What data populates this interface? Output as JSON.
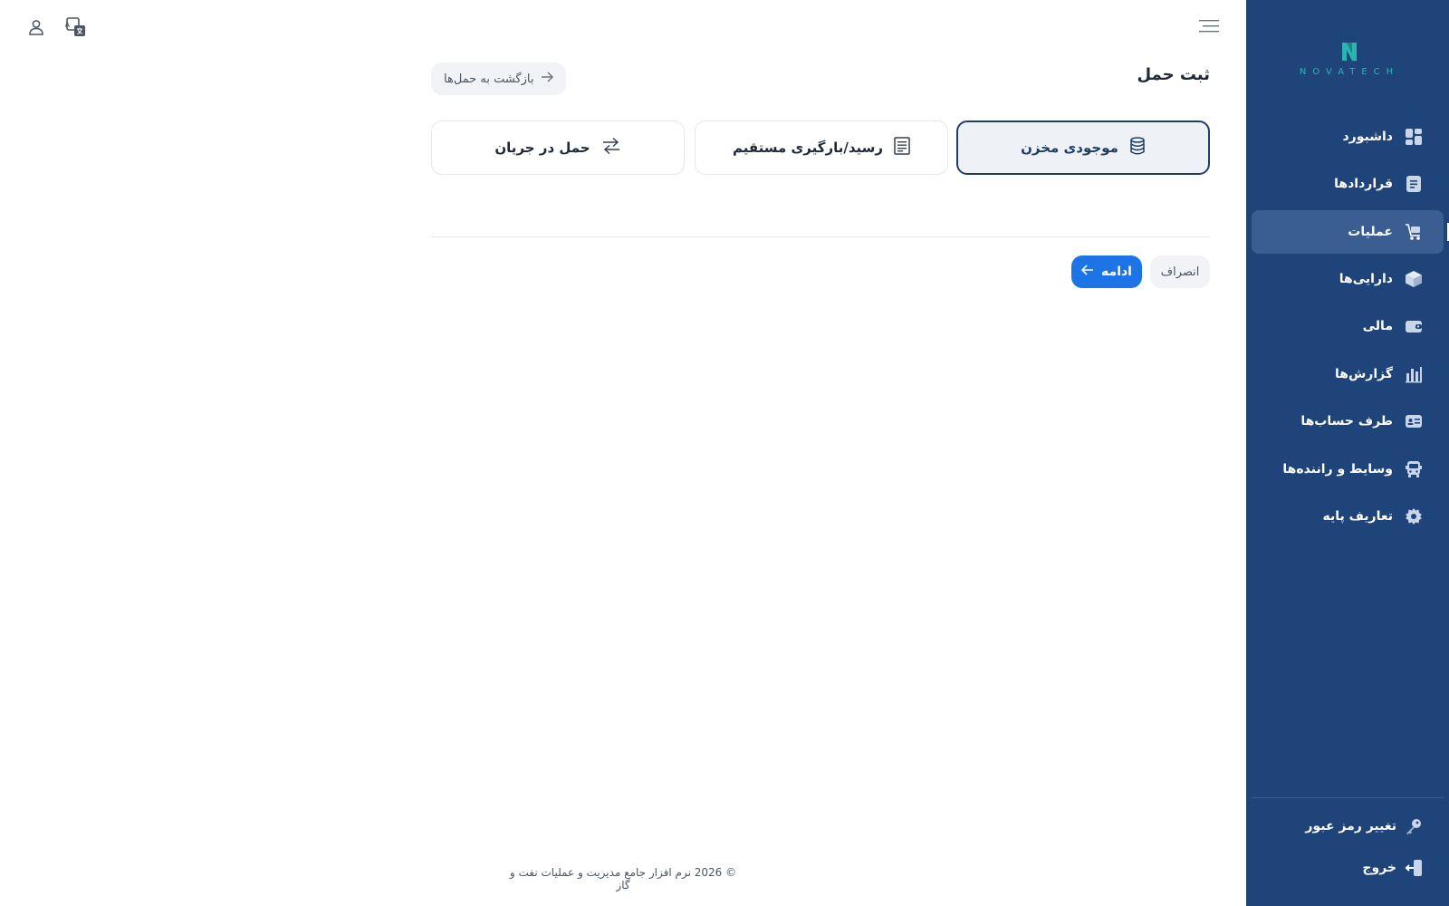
{
  "sidebar": {
    "logo_text": "NOVATECH",
    "items": [
      {
        "label": "داشبورد",
        "icon": "dashboard-icon"
      },
      {
        "label": "قراردادها",
        "icon": "document-icon"
      },
      {
        "label": "عملیات",
        "icon": "truck-icon",
        "active": true
      },
      {
        "label": "دارایی‌ها",
        "icon": "box-icon"
      },
      {
        "label": "مالی",
        "icon": "wallet-icon"
      },
      {
        "label": "گزارش‌ها",
        "icon": "bar-chart-icon"
      },
      {
        "label": "طرف حساب‌ها",
        "icon": "id-card-icon"
      },
      {
        "label": "وسایط و راننده‌ها",
        "icon": "bus-icon"
      },
      {
        "label": "تعاریف پایه",
        "icon": "gear-icon"
      }
    ],
    "bottom": [
      {
        "label": "تغییر رمز عبور",
        "icon": "key-icon"
      },
      {
        "label": "خروج",
        "icon": "logout-icon"
      }
    ]
  },
  "header": {
    "title": "ثبت حمل",
    "back_label": "بازگشت به حمل‌ها"
  },
  "options": [
    {
      "label": "موجودی مخزن",
      "icon": "database-icon",
      "selected": true
    },
    {
      "label": "رسید/بارگیری مستقیم",
      "icon": "receipt-icon",
      "selected": false
    },
    {
      "label": "حمل در جریان",
      "icon": "transfer-icon",
      "selected": false
    }
  ],
  "actions": {
    "cancel_label": "انصراف",
    "continue_label": "ادامه"
  },
  "footer": {
    "text": "© 2026 نرم افزار جامع مدیریت و عملیات نفت و گاز"
  },
  "colors": {
    "sidebar_bg": "#1f4479",
    "sidebar_active": "#3a5e92",
    "primary": "#1d74e6",
    "selected_border": "#1f3e66"
  }
}
